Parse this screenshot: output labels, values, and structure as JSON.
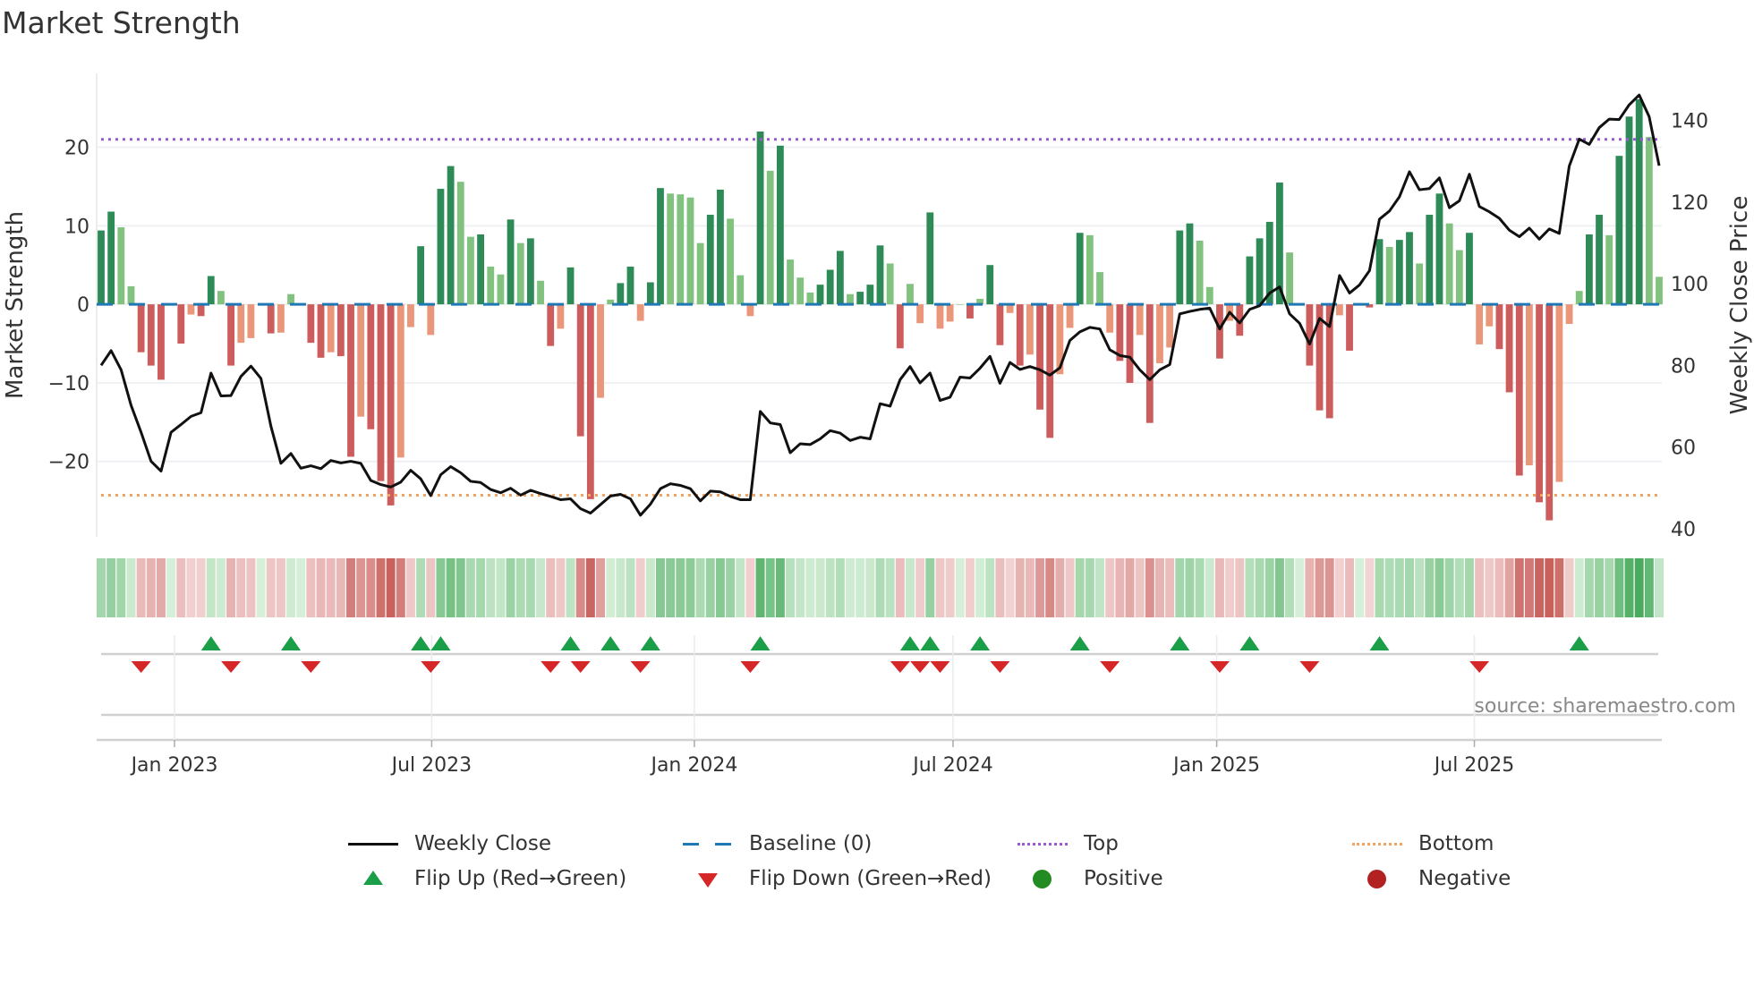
{
  "chart_data": {
    "type": "bar",
    "title": "Market Strength",
    "ylabel": "Market Strength",
    "y2label": "Weekly Close Price",
    "ylim": [
      -29.6,
      29.4
    ],
    "y2lim": [
      38,
      151.5
    ],
    "yticks": [
      20,
      10,
      0,
      -10,
      -20
    ],
    "ytick_labels": [
      "20",
      "10",
      "0",
      "−10",
      "−20"
    ],
    "y2ticks": [
      140,
      120,
      100,
      80,
      60,
      40
    ],
    "y2tick_labels": [
      "140",
      "120",
      "100",
      "80",
      "60",
      "40"
    ],
    "top_level": 21,
    "bottom_level": -24.3,
    "baseline": 0,
    "x_ticks": [
      {
        "label": "Jan 2023",
        "week": 7.35
      },
      {
        "label": "Jul 2023",
        "week": 33.1
      },
      {
        "label": "Jan 2024",
        "week": 59.4
      },
      {
        "label": "Jul 2024",
        "week": 85.3
      },
      {
        "label": "Jan 2025",
        "week": 111.7
      },
      {
        "label": "Jul 2025",
        "week": 137.5
      }
    ],
    "series": [
      {
        "name": "Market Strength",
        "values": [
          9.4,
          11.8,
          9.8,
          2.3,
          -6.1,
          -7.8,
          -9.6,
          0,
          -5,
          -1.3,
          -1.5,
          3.6,
          1.7,
          -7.8,
          -4.9,
          -4.3,
          0,
          -3.7,
          -3.6,
          1.3,
          0,
          -4.9,
          -6.8,
          -6.1,
          -6.6,
          -19.4,
          -14.3,
          -15.9,
          -22.5,
          -25.6,
          -19.5,
          -2.9,
          7.4,
          -3.9,
          14.7,
          17.6,
          15.6,
          8.6,
          8.9,
          4.8,
          3.8,
          10.8,
          7.8,
          8.4,
          3.0,
          -5.3,
          -3.1,
          4.7,
          -16.8,
          -24.8,
          -11.9,
          0.6,
          2.7,
          4.8,
          -2.1,
          2.8,
          14.8,
          14.1,
          14.0,
          13.6,
          7.8,
          11.4,
          14.6,
          10.9,
          3.7,
          -1.5,
          22,
          17,
          20.2,
          5.7,
          3.4,
          1.5,
          2.5,
          4.4,
          6.8,
          1.3,
          1.6,
          2.5,
          7.5,
          5.2,
          -5.6,
          2.6,
          -2.4,
          11.7,
          -3.1,
          -2.2,
          0,
          -1.8,
          0.7,
          5,
          -5.2,
          -1.1,
          -7.8,
          -6.4,
          -13.4,
          -17,
          -8.9,
          -3,
          9.1,
          8.8,
          4.1,
          -3.6,
          -7.2,
          -10,
          -3.9,
          -15.1,
          -7.5,
          -5.5,
          9.4,
          10.3,
          8.1,
          2.2,
          -6.9,
          -2.1,
          -4,
          6.1,
          8.4,
          10.5,
          15.5,
          6.6,
          0,
          -7.8,
          -13.5,
          -14.5,
          -1.4,
          -5.9,
          0,
          -0.4,
          8.3,
          7.3,
          8.2,
          9.2,
          5.2,
          11.4,
          14.1,
          10.3,
          6.9,
          9.1,
          -5.1,
          -2.8,
          -5.7,
          -11.2,
          -21.8,
          -20.5,
          -25.2,
          -27.5,
          -22.6,
          -2.5,
          1.7,
          8.9,
          11.4,
          8.8,
          18.9,
          23.9,
          26.1,
          21.3,
          3.5
        ]
      },
      {
        "name": "Weekly Close",
        "values": [
          80,
          83.6,
          78.9,
          70.2,
          63.6,
          56.5,
          54.1,
          63.6,
          65.5,
          67.5,
          68.4,
          78.1,
          72.5,
          72.6,
          77.3,
          79.8,
          76.8,
          65.1,
          56,
          58.4,
          54.8,
          55.4,
          54.7,
          56.7,
          56.1,
          56.5,
          56,
          51.8,
          50.8,
          50.2,
          51.4,
          54.3,
          52.2,
          48.1,
          53.2,
          55.2,
          53.7,
          51.6,
          51.3,
          49.6,
          48.8,
          49.9,
          48.2,
          49.4,
          48.6,
          47.9,
          47.1,
          47.3,
          44.9,
          43.8,
          45.9,
          48,
          48.4,
          47.3,
          43.3,
          46,
          49.8,
          51,
          50.6,
          49.8,
          46.8,
          49.2,
          49,
          47.9,
          47.1,
          47.1,
          68.7,
          65.9,
          65.5,
          58.6,
          60.8,
          60.6,
          62,
          64,
          63.4,
          61.6,
          62.4,
          62,
          70.6,
          70,
          76.5,
          79.7,
          75.7,
          78.1,
          71.4,
          72.2,
          77.1,
          76.9,
          79.3,
          82.2,
          75.6,
          80.7,
          79,
          79.7,
          78.9,
          77.6,
          79.4,
          86.1,
          88.2,
          89.3,
          88.9,
          83.8,
          82.4,
          82,
          78.9,
          76.5,
          78.9,
          80.2,
          92.6,
          93.2,
          93.7,
          94,
          88.9,
          93,
          90.4,
          93.7,
          94.6,
          97.7,
          99.2,
          92.6,
          90.3,
          85.2,
          91.5,
          89.5,
          102,
          97.7,
          99.7,
          103.2,
          115.8,
          117.8,
          121.3,
          127.4,
          123,
          123.3,
          125.9,
          118.6,
          120.3,
          126.8,
          118.9,
          117.6,
          116,
          113.1,
          111.5,
          113.6,
          110.9,
          113.4,
          112.3,
          128.8,
          135.4,
          134.1,
          138.2,
          140.3,
          140.2,
          143.8,
          146.2,
          140.9,
          128.9
        ]
      }
    ],
    "legend": {
      "placement": "bottom-center",
      "items": [
        {
          "label": "Weekly Close",
          "symbol": "line"
        },
        {
          "label": "Baseline (0)",
          "symbol": "dash"
        },
        {
          "label": "Top",
          "symbol": "dot-purple"
        },
        {
          "label": "Bottom",
          "symbol": "dot-orange"
        },
        {
          "label": "Flip Up (Red→Green)",
          "symbol": "triangle-up"
        },
        {
          "label": "Flip Down (Green→Red)",
          "symbol": "triangle-down"
        },
        {
          "label": "Positive",
          "symbol": "circle-green"
        },
        {
          "label": "Negative",
          "symbol": "circle-red"
        }
      ]
    },
    "source": "source: sharemaestro.com"
  },
  "colors": {
    "pos_dark": "#2e8b57",
    "pos_light": "#80c27e",
    "neg_dark": "#cd5c5c",
    "neg_light": "#e9967a",
    "baseline": "#1f77b4",
    "top": "#9b59d6",
    "bottom": "#f4a460",
    "flip_up": "#1a9e48",
    "flip_down": "#d62728",
    "positive": "#228b22",
    "negative": "#b22222",
    "line": "#111111"
  }
}
